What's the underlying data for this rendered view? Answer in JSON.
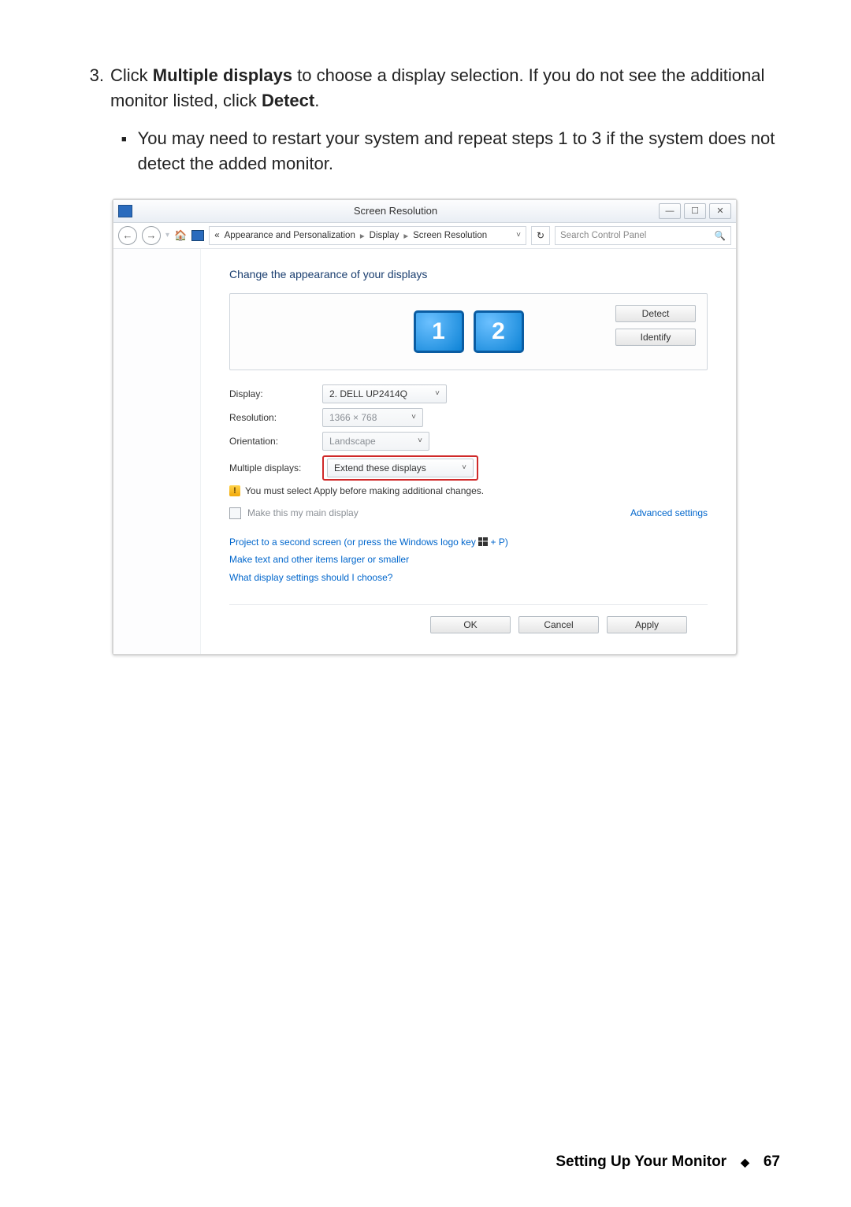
{
  "instructions": {
    "step_number": "3.",
    "step_line1": "Click ",
    "step_bold1": "Multiple displays",
    "step_line2": " to choose a display selection. If you do not see the additional monitor listed, click ",
    "step_bold2": "Detect",
    "step_line3": ".",
    "sub_bullet": "You may need to restart your system and repeat steps 1 to 3 if the system does not detect the added monitor."
  },
  "window": {
    "title": "Screen Resolution",
    "breadcrumb_pre": "«",
    "breadcrumb1": "Appearance and Personalization",
    "breadcrumb2": "Display",
    "breadcrumb3": "Screen Resolution",
    "search_placeholder": "Search Control Panel",
    "heading": "Change the appearance of your displays",
    "monitor1": "1",
    "monitor2": "2",
    "btn_detect": "Detect",
    "btn_identify": "Identify",
    "labels": {
      "display": "Display:",
      "resolution": "Resolution:",
      "orientation": "Orientation:",
      "multiple": "Multiple displays:"
    },
    "values": {
      "display": "2. DELL UP2414Q",
      "resolution": "1366 × 768",
      "orientation": "Landscape",
      "multiple": "Extend these displays"
    },
    "warning": "You must select Apply before making additional changes.",
    "checkbox_label": "Make this my main display",
    "advanced": "Advanced settings",
    "links": {
      "project_a": "Project to a second screen (or press the Windows logo key ",
      "project_b": " + P)",
      "textsize": "Make text and other items larger or smaller",
      "help": "What display settings should I choose?"
    },
    "btn_ok": "OK",
    "btn_cancel": "Cancel",
    "btn_apply": "Apply"
  },
  "footer": {
    "section": "Setting Up Your Monitor",
    "page": "67"
  }
}
